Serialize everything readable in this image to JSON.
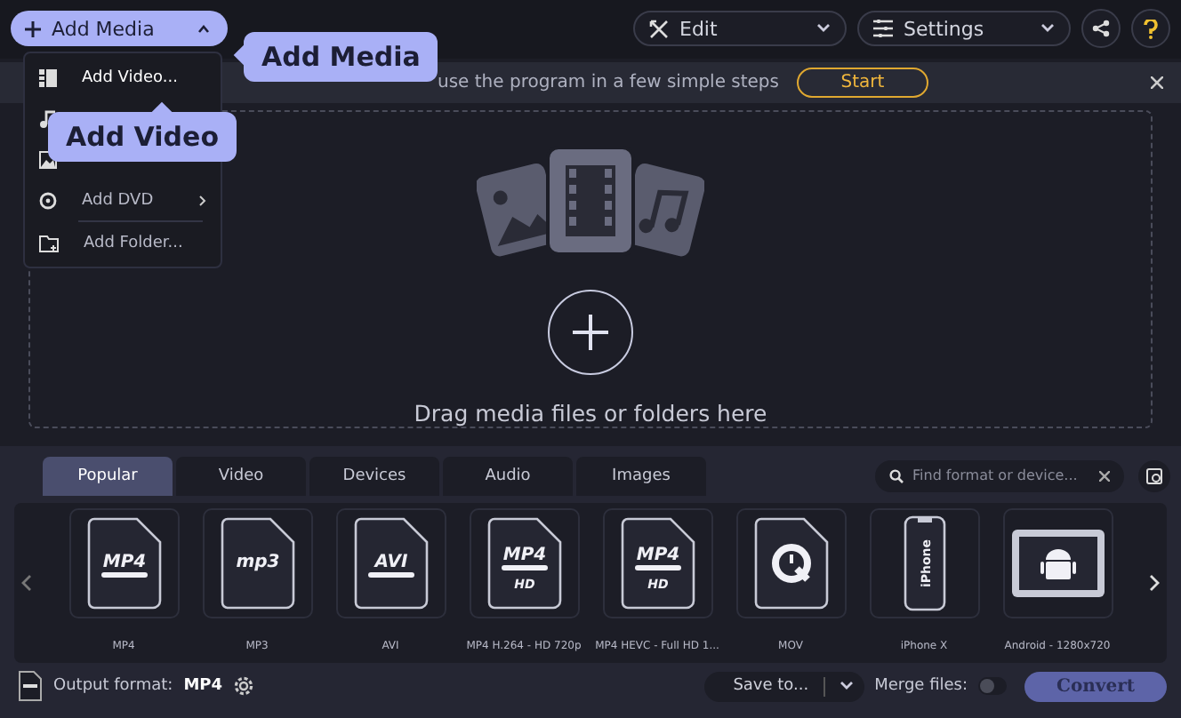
{
  "toolbar": {
    "add_media": "Add Media",
    "edit": "Edit",
    "settings": "Settings"
  },
  "add_menu": {
    "expanded": true,
    "items": [
      {
        "kind": "video",
        "label": "Add Video...",
        "selected": true
      },
      {
        "kind": "audio",
        "selected": false
      },
      {
        "kind": "image",
        "selected": false
      },
      {
        "kind": "dvd",
        "label": "Add DVD",
        "selected": false
      },
      {
        "kind": "folder",
        "label": "Add Folder...",
        "selected": false
      }
    ]
  },
  "callouts": [
    {
      "kind": "media",
      "text": "Add Media"
    },
    {
      "kind": "video",
      "text": "Add Video"
    }
  ],
  "banner": {
    "text": "use the program in a few simple steps",
    "button": "Start"
  },
  "drop_zone": {
    "text": "Drag media files or folders here"
  },
  "format_tabs": [
    {
      "label": "Popular",
      "selected": true
    },
    {
      "label": "Video",
      "selected": false
    },
    {
      "label": "Devices",
      "selected": false
    },
    {
      "label": "Audio",
      "selected": false
    },
    {
      "label": "Images",
      "selected": false
    }
  ],
  "format_search": {
    "placeholder": "Find format or device..."
  },
  "formats": [
    {
      "kind": "file",
      "icon_text": "MP4",
      "label": "MP4"
    },
    {
      "kind": "file",
      "icon_text": "mp3",
      "label": "MP3"
    },
    {
      "kind": "file",
      "icon_text": "AVI",
      "label": "AVI"
    },
    {
      "kind": "file",
      "icon_text": "MP4",
      "hd_text": "HD",
      "label": "MP4 H.264 - HD 720p"
    },
    {
      "kind": "file",
      "icon_text": "MP4",
      "hd_text": "HD",
      "label": "MP4 HEVC - Full HD 1..."
    },
    {
      "kind": "quicktime",
      "label": "MOV"
    },
    {
      "kind": "phone",
      "icon_text": "iPhone",
      "label": "iPhone X"
    },
    {
      "kind": "tablet",
      "label": "Android - 1280x720"
    }
  ],
  "footer": {
    "output_label": "Output format:",
    "output_value": "MP4",
    "save_to": "Save to...",
    "merge_label": "Merge files:",
    "merge_on": false,
    "convert": "Convert"
  }
}
